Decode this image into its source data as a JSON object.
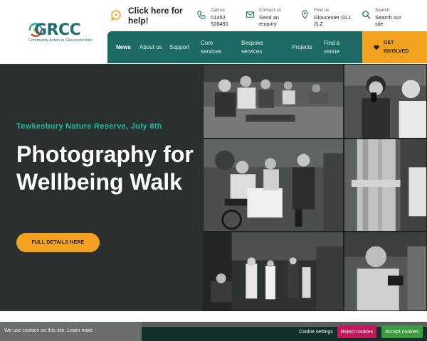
{
  "header": {
    "logo": {
      "wordmark": "GRCC",
      "tagline": "Community Action in Gloucestershire"
    },
    "help": {
      "label": "Click here for help!"
    },
    "contacts": [
      {
        "small": "Call us",
        "value_lines": [
          "01452",
          "528491"
        ]
      },
      {
        "small": "Contact us",
        "value_lines": [
          "Send an",
          "enquiry"
        ]
      },
      {
        "small": "Find us",
        "value_lines": [
          "Gloucester GL1",
          "2LZ"
        ]
      },
      {
        "small": "Search",
        "value_lines": [
          "Search our",
          "site"
        ]
      }
    ]
  },
  "nav": {
    "items": [
      {
        "label": "News",
        "active": true
      },
      {
        "label": "About us",
        "active": false
      },
      {
        "label": "Support",
        "active": false
      },
      {
        "label": "Core services",
        "active": false
      },
      {
        "label": "Bespoke services",
        "active": false
      },
      {
        "label": "Projects",
        "active": false
      },
      {
        "label": "Find a venue",
        "active": false
      }
    ],
    "get_involved": "GET INVOLVED"
  },
  "hero": {
    "event_line": "Tewkesbury Nature Reserve, July 8th",
    "title": "Photography for Wellbeing Walk",
    "button": "FULL DETAILS HERE"
  },
  "cookie_bar": {
    "text": "We use cookies on this site.",
    "learn_more": "Learn more",
    "settings": "Cookie settings",
    "reject": "Reject cookies",
    "accept": "Accept cookies"
  },
  "colors": {
    "accent_orange": "#f3a21f",
    "nav_teal": "#1b6b62",
    "hero_dark": "#2a302e",
    "event_teal": "#1fb9a8"
  }
}
